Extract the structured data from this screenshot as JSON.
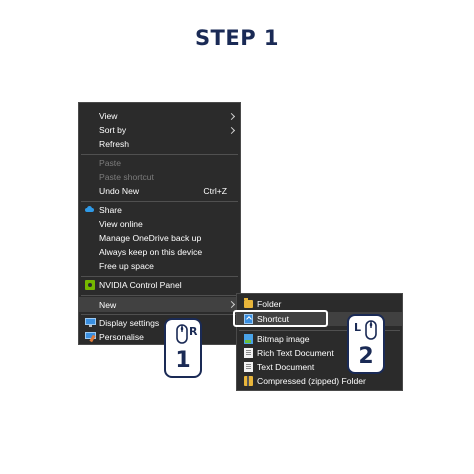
{
  "title": "STEP 1",
  "context_menu": {
    "items": [
      {
        "label": "View",
        "submenu": true
      },
      {
        "label": "Sort by",
        "submenu": true
      },
      {
        "label": "Refresh"
      },
      {
        "label": "Paste",
        "disabled": true
      },
      {
        "label": "Paste shortcut",
        "disabled": true
      },
      {
        "label": "Undo New",
        "shortcut": "Ctrl+Z"
      },
      {
        "label": "Share",
        "icon": "onedrive-cloud-icon"
      },
      {
        "label": "View online"
      },
      {
        "label": "Manage OneDrive back up"
      },
      {
        "label": "Always keep on this device"
      },
      {
        "label": "Free up space"
      },
      {
        "label": "NVIDIA Control Panel",
        "icon": "nvidia-icon"
      },
      {
        "label": "New",
        "submenu": true,
        "highlighted": true
      },
      {
        "label": "Display settings",
        "icon": "display-settings-icon"
      },
      {
        "label": "Personalise",
        "icon": "personalise-icon"
      }
    ]
  },
  "new_submenu": {
    "items": [
      {
        "label": "Folder",
        "icon": "folder-icon"
      },
      {
        "label": "Shortcut",
        "icon": "shortcut-icon",
        "highlighted": true
      },
      {
        "label": "Bitmap image",
        "icon": "bitmap-icon"
      },
      {
        "label": "Rich Text Document",
        "icon": "document-icon"
      },
      {
        "label": "Text Document",
        "icon": "document-icon"
      },
      {
        "label": "Compressed (zipped) Folder",
        "icon": "zip-folder-icon"
      }
    ]
  },
  "callouts": [
    {
      "number": "1",
      "button": "R",
      "icon": "mouse-right-click-icon"
    },
    {
      "number": "2",
      "button": "L",
      "icon": "mouse-left-click-icon"
    }
  ],
  "colors": {
    "accent": "#1a2a55",
    "menu_bg": "#2b2b2b",
    "menu_text": "#ffffff",
    "disabled_text": "#7c7c7c",
    "hover_bg": "#414141"
  }
}
